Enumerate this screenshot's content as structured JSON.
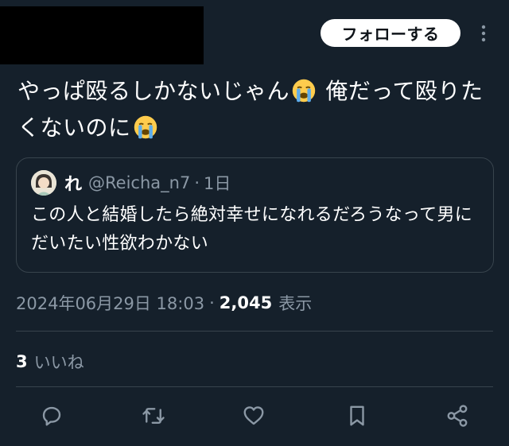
{
  "header": {
    "follow_label": "フォローする",
    "more_icon": "more-vertical-icon"
  },
  "tweet": {
    "text_part1": "やっぱ殴るしかないじゃん",
    "text_part2": " 俺だって殴りたくないのに",
    "emoji": "loudly-crying-face"
  },
  "quote": {
    "name": "れ",
    "handle": "@Reicha_n7",
    "separator": "·",
    "time": "1日",
    "text": "この人と結婚したら絶対幸せになれるだろうなって男にだいたい性欲わかない"
  },
  "meta": {
    "timestamp": "2024年06月29日 18:03",
    "separator": "·",
    "views": "2,045",
    "views_label": "表示"
  },
  "likes": {
    "count": "3",
    "label": "いいね"
  },
  "actions": [
    {
      "name": "reply",
      "icon": "reply-icon"
    },
    {
      "name": "retweet",
      "icon": "retweet-icon"
    },
    {
      "name": "like",
      "icon": "heart-icon"
    },
    {
      "name": "bookmark",
      "icon": "bookmark-icon"
    },
    {
      "name": "share",
      "icon": "share-icon"
    }
  ],
  "colors": {
    "background": "#15202b",
    "text": "#ffffff",
    "secondary_text": "#8b98a5",
    "border": "#38444d",
    "icon": "#8b98a5"
  }
}
